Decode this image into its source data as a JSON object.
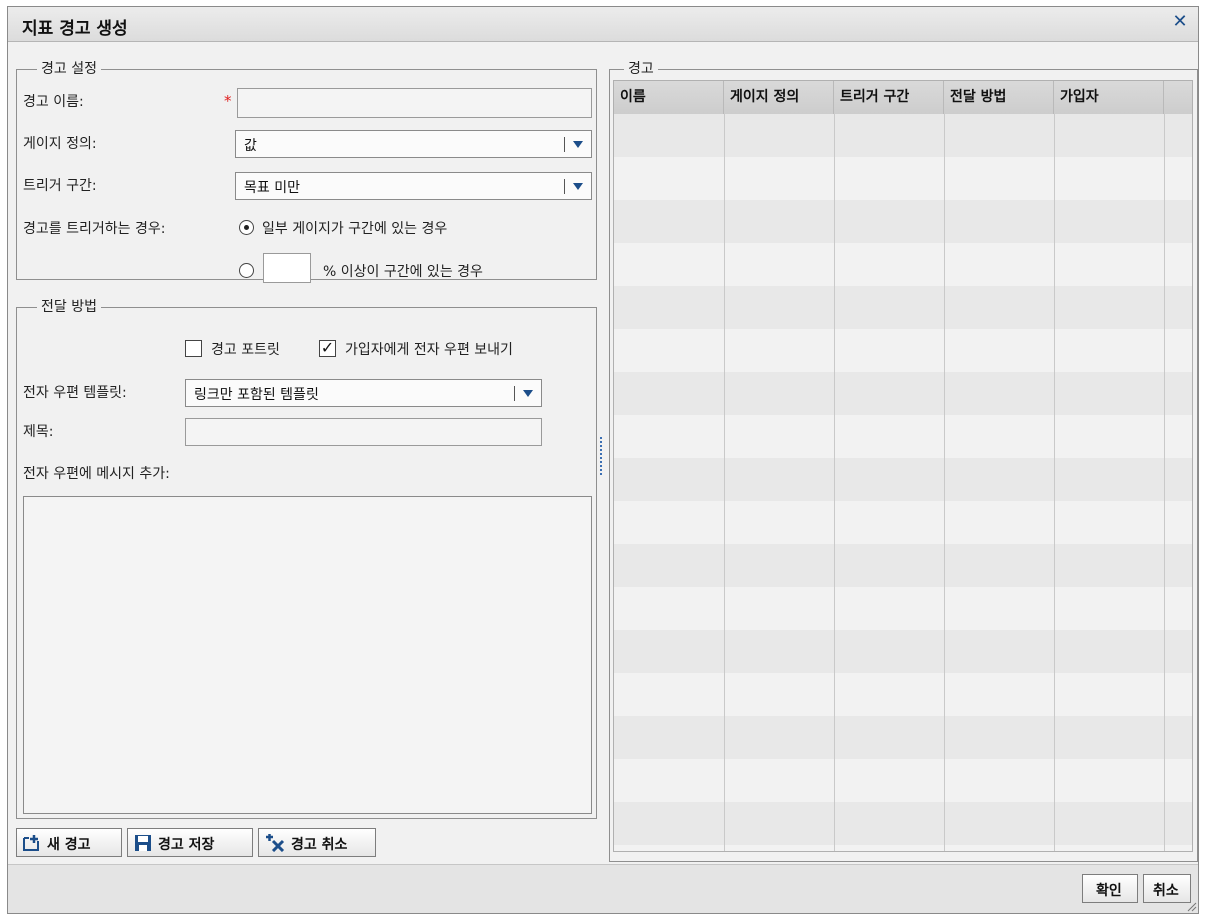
{
  "dialog": {
    "title": "지표 경고 생성",
    "close_symbol": "✕"
  },
  "alert_settings": {
    "legend": "경고 설정",
    "name_label": "경고 이름:",
    "name_value": "",
    "gauge_label": "게이지 정의:",
    "gauge_value": "값",
    "trigger_label": "트리거 구간:",
    "trigger_value": "목표 미만",
    "condition_label": "경고를 트리거하는 경우:",
    "option_some": "일부 게이지가 구간에 있는 경우",
    "percent_value": "",
    "option_percent": "% 이상이 구간에 있는 경우"
  },
  "delivery": {
    "legend": "전달 방법",
    "portlet_label": "경고 포트릿",
    "portlet_checked": false,
    "email_label": "가입자에게 전자 우편 보내기",
    "email_checked": true,
    "template_label": "전자 우편 템플릿:",
    "template_value": "링크만 포함된 템플릿",
    "subject_label": "제목:",
    "subject_value": "",
    "message_label": "전자 우편에 메시지 추가:",
    "message_value": ""
  },
  "actions": {
    "new_label": "새 경고",
    "save_label": "경고 저장",
    "cancel_label": "경고 취소"
  },
  "alerts_table": {
    "legend": "경고",
    "columns": [
      "이름",
      "게이지 정의",
      "트리거 구간",
      "전달 방법",
      "가입자"
    ]
  },
  "footer": {
    "ok_label": "확인",
    "cancel_label": "취소"
  },
  "colors": {
    "required": "#e02020",
    "accent": "#1c4e8a",
    "row_alt": "#e8e8e8",
    "row": "#f2f2f2"
  }
}
